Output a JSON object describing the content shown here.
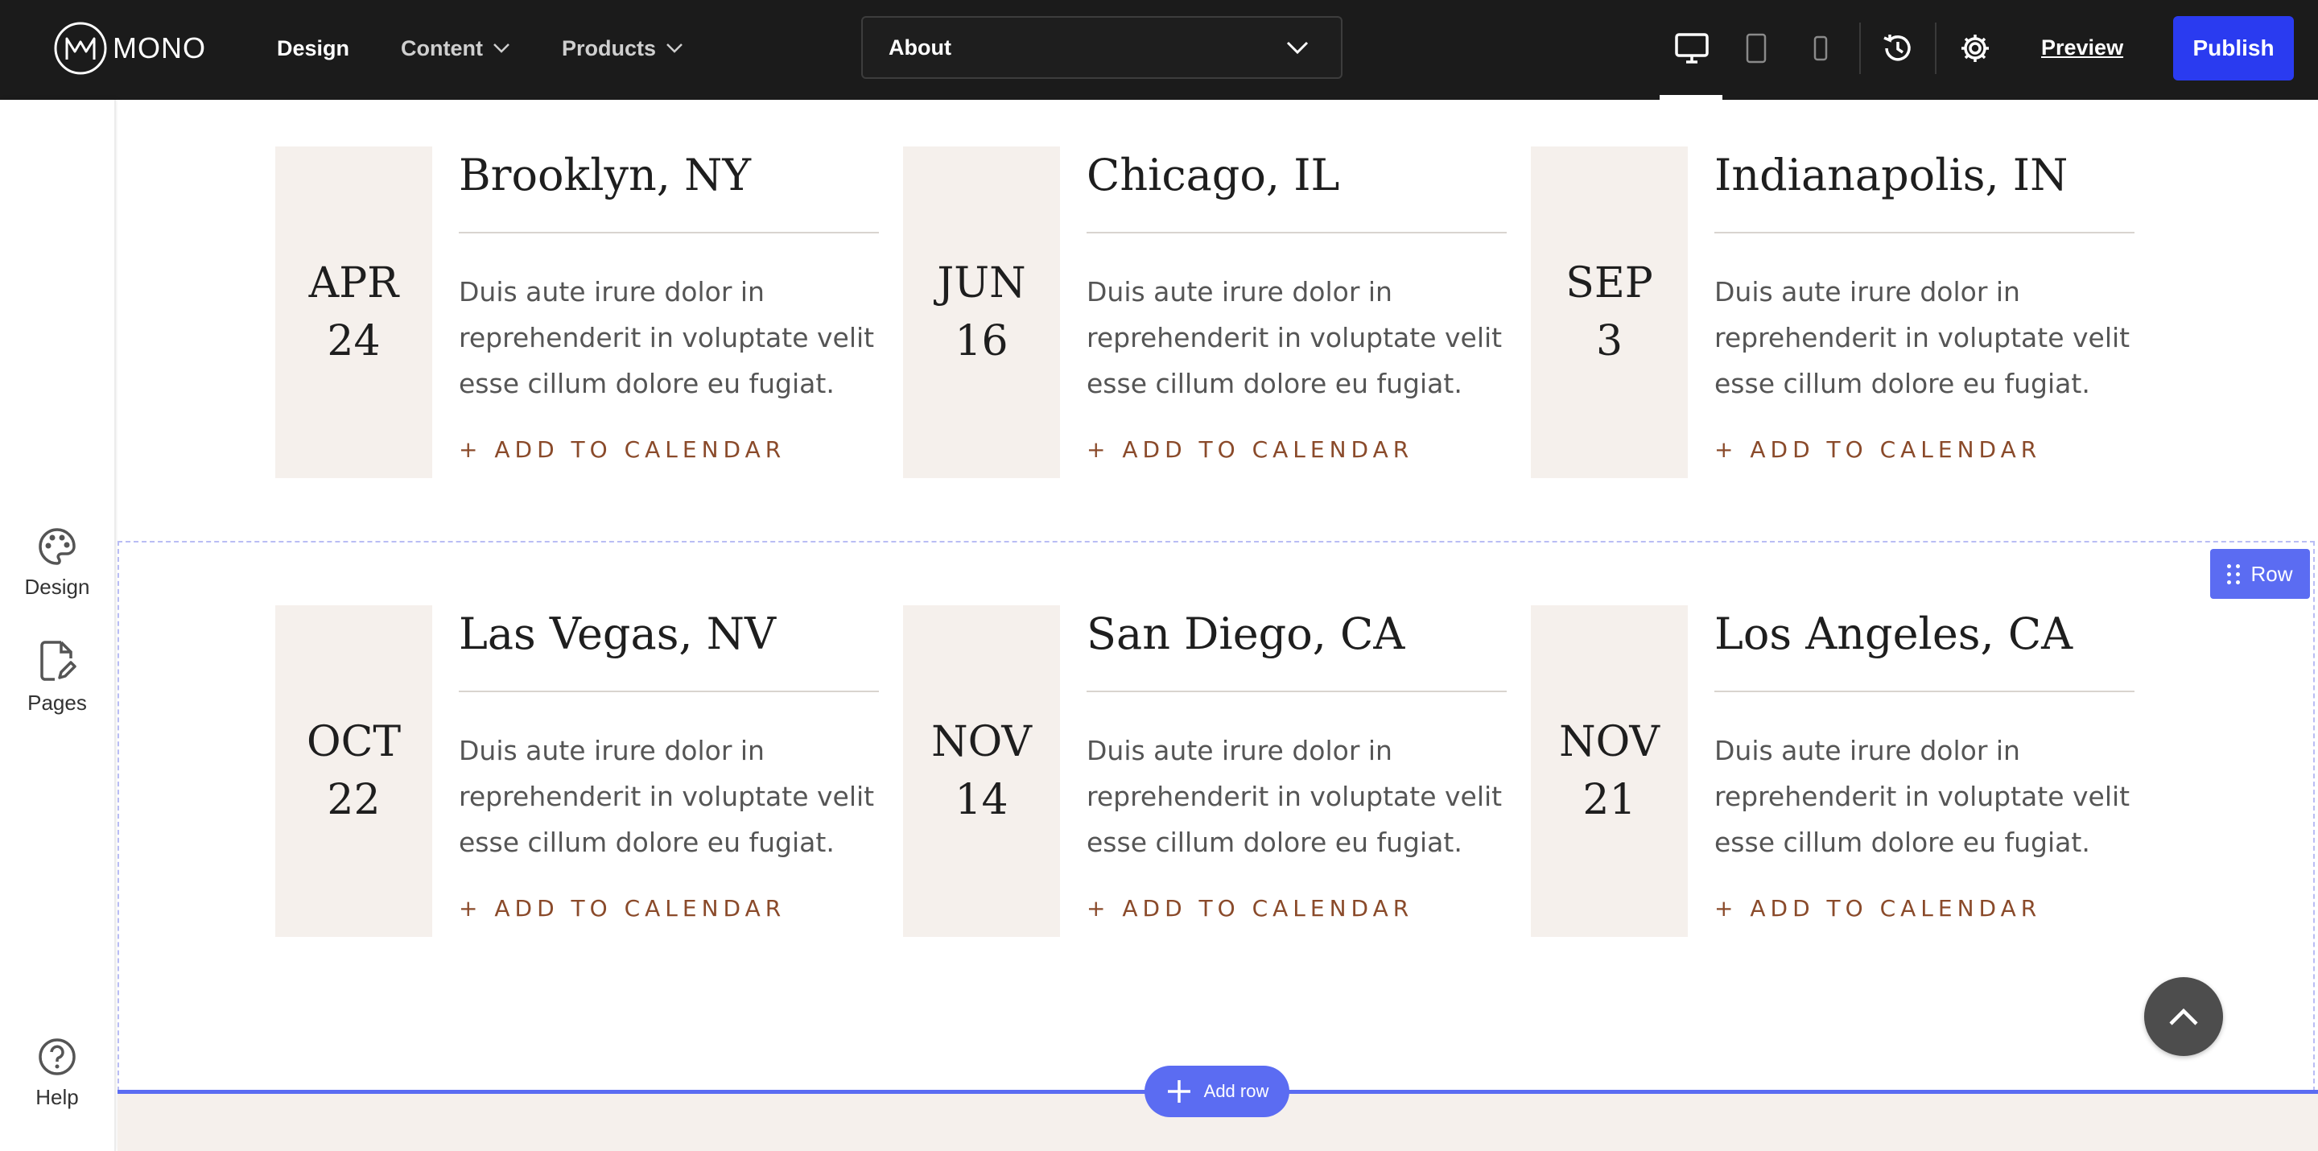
{
  "topbar": {
    "logo_text": "MONO",
    "nav": [
      {
        "label": "Design"
      },
      {
        "label": "Content"
      },
      {
        "label": "Products"
      }
    ],
    "page_select": {
      "value": "About"
    },
    "preview_label": "Preview",
    "publish_label": "Publish"
  },
  "sidebar": {
    "items": [
      {
        "label": "Design",
        "icon": "palette-icon"
      },
      {
        "label": "Pages",
        "icon": "page-edit-icon"
      },
      {
        "label": "Help",
        "icon": "help-icon"
      }
    ]
  },
  "canvas": {
    "row_tag_label": "Row",
    "add_row_label": "Add row",
    "events": [
      {
        "month": "APR",
        "day": "24",
        "city": "Brooklyn, NY",
        "desc": "Duis aute irure dolor in reprehenderit in voluptate velit esse cillum dolore eu fugiat.",
        "cta": "+ ADD TO CALENDAR"
      },
      {
        "month": "JUN",
        "day": "16",
        "city": "Chicago, IL",
        "desc": "Duis aute irure dolor in reprehenderit in voluptate velit esse cillum dolore eu fugiat.",
        "cta": "+ ADD TO CALENDAR"
      },
      {
        "month": "SEP",
        "day": "3",
        "city": "Indianapolis, IN",
        "desc": "Duis aute irure dolor in reprehenderit in voluptate velit esse cillum dolore eu fugiat.",
        "cta": "+ ADD TO CALENDAR"
      },
      {
        "month": "OCT",
        "day": "22",
        "city": "Las Vegas, NV",
        "desc": "Duis aute irure dolor in reprehenderit in voluptate velit esse cillum dolore eu fugiat.",
        "cta": "+ ADD TO CALENDAR"
      },
      {
        "month": "NOV",
        "day": "14",
        "city": "San Diego, CA",
        "desc": "Duis aute irure dolor in reprehenderit in voluptate velit esse cillum dolore eu fugiat.",
        "cta": "+ ADD TO CALENDAR"
      },
      {
        "month": "NOV",
        "day": "21",
        "city": "Los Angeles, CA",
        "desc": "Duis aute irure dolor in reprehenderit in voluptate velit esse cillum dolore eu fugiat.",
        "cta": "+ ADD TO CALENDAR"
      }
    ]
  },
  "colors": {
    "topbar_bg": "#1b1b1b",
    "publish_bg": "#2a3bf0",
    "accent": "#5b6cf2",
    "date_box_bg": "#f5f0ec",
    "cta_text": "#8a4a2a"
  }
}
